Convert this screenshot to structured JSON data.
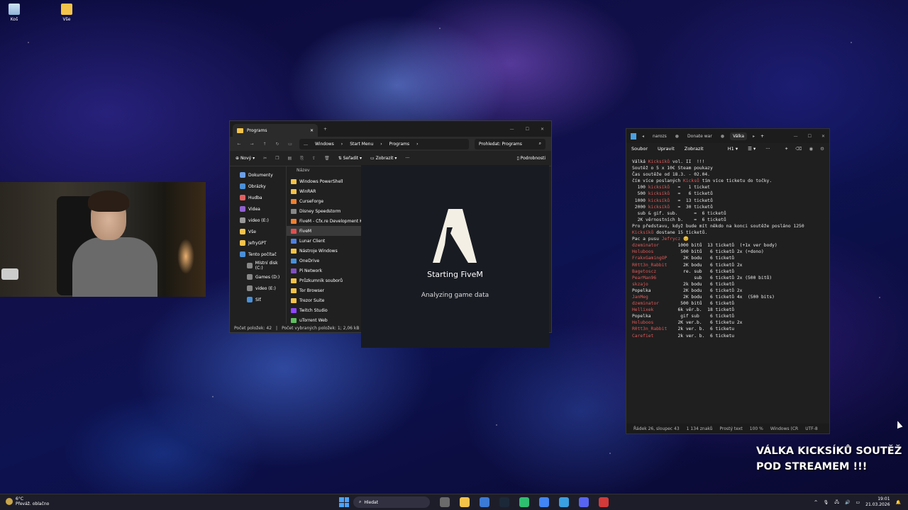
{
  "desktop": {
    "icons": [
      {
        "label": "Koš",
        "icon": "recycle-bin-icon"
      },
      {
        "label": "Vše",
        "icon": "folder-icon"
      }
    ]
  },
  "explorer": {
    "tab_title": "Programs",
    "breadcrumb": [
      "…",
      "Windows",
      "Start Menu",
      "Programs"
    ],
    "search_placeholder": "Prohledat: Programs",
    "toolbar": {
      "new": "Nový",
      "sort": "Seřadit",
      "view": "Zobrazit",
      "details": "Podrobnosti"
    },
    "sidebar": [
      {
        "label": "Dokumenty",
        "color": "#6aa0e8"
      },
      {
        "label": "Obrázky",
        "color": "#4a90d9"
      },
      {
        "label": "Hudba",
        "color": "#e06060"
      },
      {
        "label": "Videa",
        "color": "#9060d0"
      },
      {
        "label": "video (E:)",
        "color": "#999999"
      },
      {
        "label": "Vše",
        "color": "#f4c34a"
      },
      {
        "label": "JefryGPT",
        "color": "#f4c34a"
      },
      {
        "label": "Tento počítač",
        "color": "#4a90d9"
      },
      {
        "label": "Místní disk (C:)",
        "color": "#888888"
      },
      {
        "label": "Games (D:)",
        "color": "#888888"
      },
      {
        "label": "video (E:)",
        "color": "#888888"
      },
      {
        "label": "Síť",
        "color": "#4a90d9"
      }
    ],
    "column_header": "Název",
    "items": [
      {
        "label": "Windows PowerShell",
        "color": "#f4c34a"
      },
      {
        "label": "WinRAR",
        "color": "#f4c34a"
      },
      {
        "label": "CurseForge",
        "color": "#f08030"
      },
      {
        "label": "Disney Speedstorm",
        "color": "#888888"
      },
      {
        "label": "FiveM - Cfx.re Development Kit (FiveM)",
        "color": "#f08030"
      },
      {
        "label": "FiveM",
        "color": "#e05050"
      },
      {
        "label": "Lunar Client",
        "color": "#5080e0"
      },
      {
        "label": "Nástroje Windows",
        "color": "#f4c34a"
      },
      {
        "label": "OneDrive",
        "color": "#4a90d9"
      },
      {
        "label": "Pi Network",
        "color": "#8050c0"
      },
      {
        "label": "Průzkumník souborů",
        "color": "#f4c34a"
      },
      {
        "label": "Tor Browser",
        "color": "#f4c34a"
      },
      {
        "label": "Trezor Suite",
        "color": "#f4c34a"
      },
      {
        "label": "Twitch Studio",
        "color": "#9146ff"
      },
      {
        "label": "uTorrent Web",
        "color": "#60c060"
      }
    ],
    "status": {
      "count": "Počet položek: 42",
      "selected": "Počet vybraných položek: 1; 2,06 kB"
    }
  },
  "fivem": {
    "title": "Starting FiveM",
    "status": "Analyzing game data"
  },
  "notepad": {
    "tabs": [
      "narozs",
      "Donate war",
      "Válka"
    ],
    "menu": [
      "Soubor",
      "Upravit",
      "Zobrazit"
    ],
    "heading_label": "H1",
    "lines": [
      {
        "t": "Válká Kicksíků vol. II  !!!"
      },
      {
        "t": ""
      },
      {
        "t": "Soutěž o 5 x 10€ Steam poukazy"
      },
      {
        "t": "Čas soutěže od 18.3. - 02.04."
      },
      {
        "t": ""
      },
      {
        "t": "čím více poslaných Kicksů tím více ticketu do točky."
      },
      {
        "t": "  100 kicksíků   =   1 ticket"
      },
      {
        "t": "  500 kicksíků   =   6 ticketů"
      },
      {
        "t": " 1000 kicksíků   =  13 ticketů"
      },
      {
        "t": " 2000 kicksíků   =  30 ticketů"
      },
      {
        "t": ""
      },
      {
        "t": "  sub & gif. sub.      =  6 ticketů"
      },
      {
        "t": "  2K věrnostních b.    =  6 ticketů"
      },
      {
        "t": ""
      },
      {
        "t": "Pro představu, když bude mít někdo na konci soutěže posláno 1250"
      },
      {
        "t": "Kicksíků dostane 15 ticketů."
      },
      {
        "t": ""
      },
      {
        "t": "Pac a pusu Jefrycz 😊"
      },
      {
        "t": ""
      },
      {
        "t": "dzeminator       1000 bitů  13 ticketů  (+1x ver body)"
      },
      {
        "t": "Holuboos          500 bitů   6 ticketů 2x (+dono)"
      },
      {
        "t": "FrakxGamingOP      2K bodu   6 ticketů"
      },
      {
        "t": "R0tt3n_Rabbit      2K bodu   6 ticketů 2x"
      },
      {
        "t": "Bagetoscz          re. sub   6 ticketů"
      },
      {
        "t": "PearMan96              sub   6 ticketů 2x (500 bitů)"
      },
      {
        "t": "skzajo             2k bodu   6 ticketů"
      },
      {
        "t": "Popelka            2K bodu   6 ticketů 2x"
      },
      {
        "t": "JanMeg             2K bodu   6 ticketů 4x  (500 bits)"
      },
      {
        "t": ""
      },
      {
        "t": "dzeminator        500 bitů   6 ticketů"
      },
      {
        "t": "Hellixek         6k věr.b.  18 ticketů"
      },
      {
        "t": "Popelka           gif sub    6 ticketů"
      },
      {
        "t": ""
      },
      {
        "t": "Holuboos         2K ver.b.   6 ticketu 2x"
      },
      {
        "t": "R0tt3n_Rabbit    2k ver. b.  6 ticketu"
      },
      {
        "t": "Carefiet         2k ver. b.  6 ticketu"
      }
    ],
    "status": [
      "Řádek 26, sloupec 43",
      "1 134 znaků",
      "Prostý text",
      "100 %",
      "Windows (CR",
      "UTF-8"
    ]
  },
  "overlay": {
    "line1": "VÁLKA KICKSÍKŮ SOUTĚŽ",
    "line2": "POD STREAMEM !!!"
  },
  "taskbar": {
    "weather_temp": "6°C",
    "weather_desc": "Převáž. oblačno",
    "search": "Hledat",
    "time": "19:01",
    "date": "21.03.2026",
    "apps": [
      "#6b6b6b",
      "#f4c34a",
      "#3b7bd6",
      "#1b2838",
      "#2fbf71",
      "#4285f4",
      "#3aa0e0",
      "#5865f2",
      "#d33a3a"
    ]
  }
}
